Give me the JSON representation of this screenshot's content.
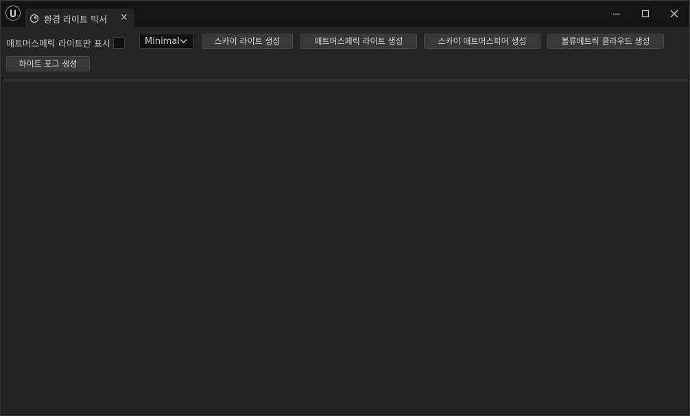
{
  "window": {
    "tab_title": "환경 라이트 믹서",
    "tab_close_glyph": "×"
  },
  "icons": {
    "app": "unreal-engine-logo-icon",
    "tab": "light-mixer-icon",
    "minimize": "minimize-icon",
    "maximize": "maximize-icon",
    "close": "close-icon",
    "dropdown": "chevron-down-icon"
  },
  "toolbar": {
    "atmospheric_only_label": "애트머스페릭 라이트만 표시",
    "atmospheric_only_checked": false,
    "view_mode_selected": "Minimal",
    "buttons": [
      "스카이 라이트 생성",
      "애트머스페릭 라이트 생성",
      "스카이 애트머스피어 생성",
      "볼류메트릭 클라우드 생성",
      "하이트 포그 생성"
    ]
  },
  "colors": {
    "titlebar": "#141414",
    "toolbar": "#242424",
    "button": "#383838",
    "content": "#222222"
  }
}
